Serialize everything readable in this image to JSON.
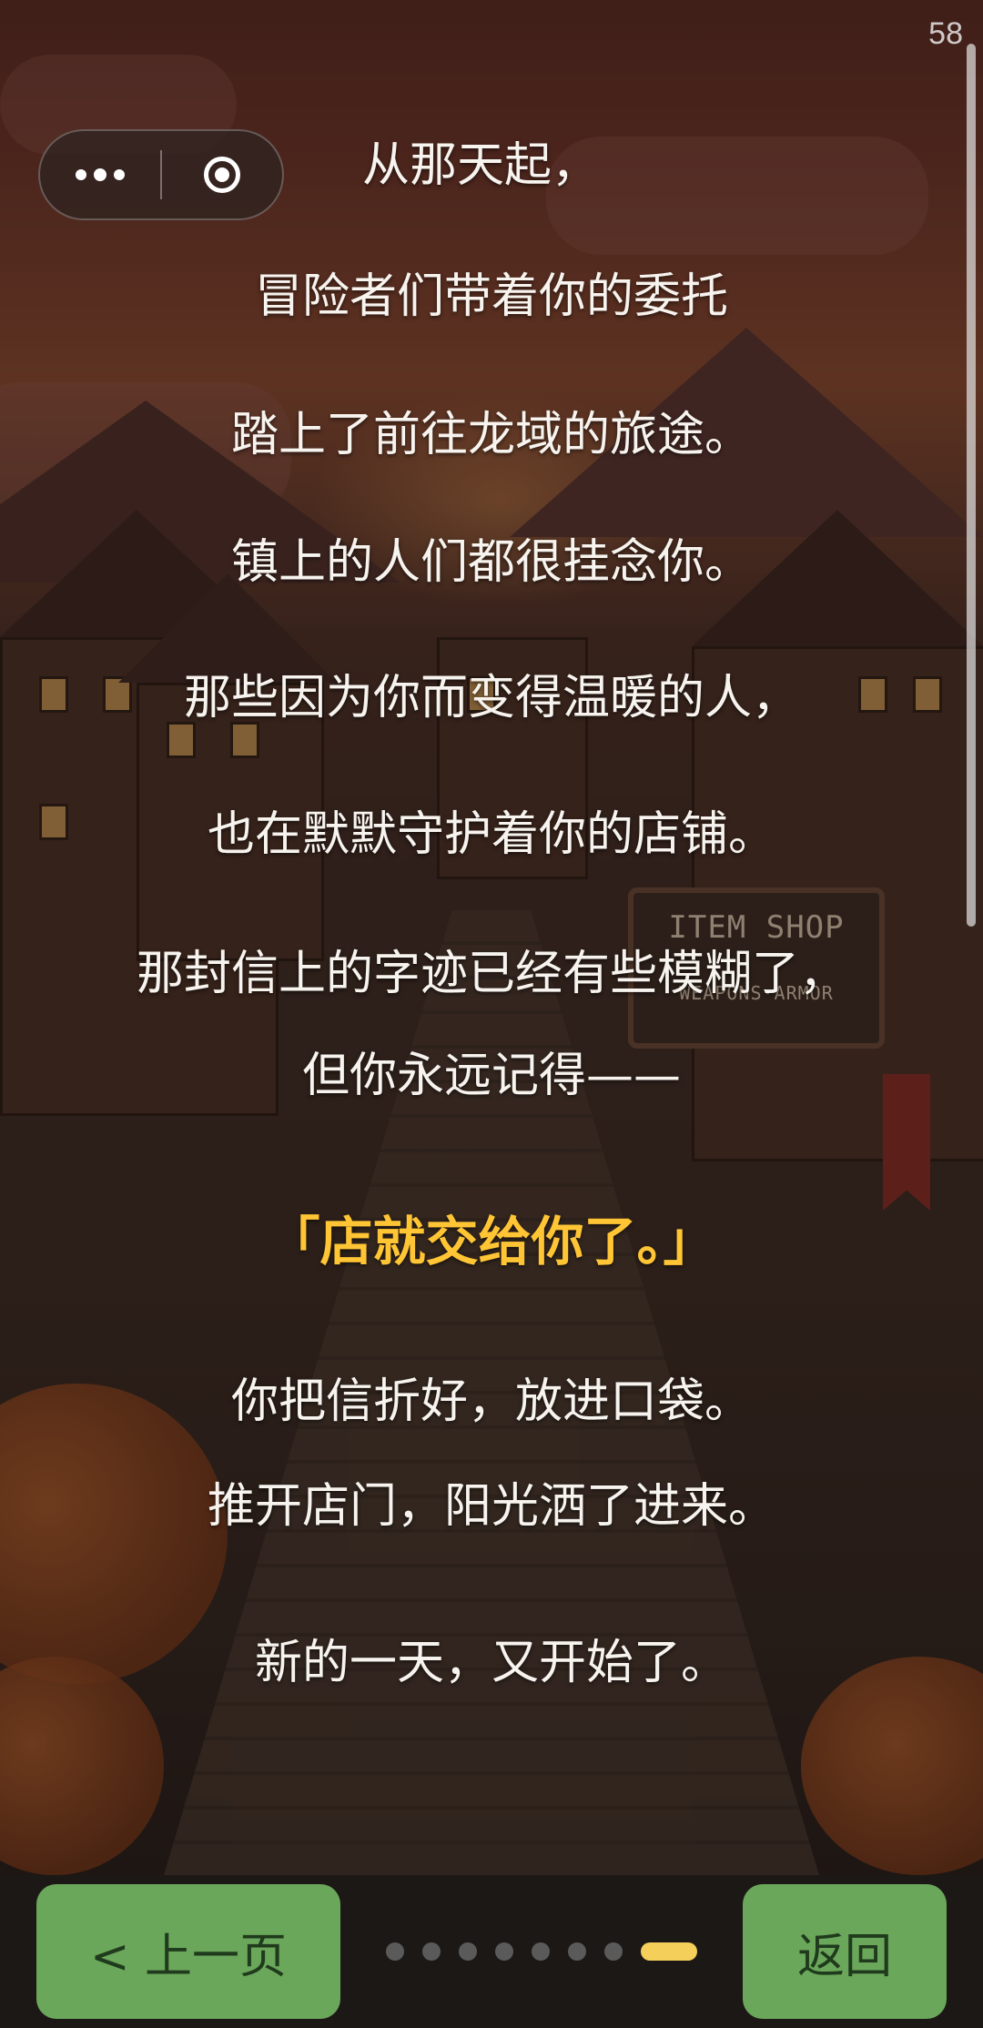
{
  "status": {
    "number": "58"
  },
  "capsule": {
    "more_icon": "more-dots-icon",
    "close_icon": "target-circle-icon"
  },
  "story": {
    "lines": [
      "从那天起，",
      "冒险者们带着你的委托",
      "踏上了前往龙域的旅途。",
      "镇上的人们都很挂念你。",
      "那些因为你而变得温暖的人，",
      "也在默默守护着你的店铺。",
      "那封信上的字迹已经有些模糊了，",
      "但你永远记得——",
      "「店就交给你了。」",
      "你把信折好，放进口袋。",
      "推开店门，阳光洒了进来。",
      "新的一天，又开始了。"
    ],
    "highlight_color": "#ffc534"
  },
  "scene": {
    "sign_line1": "ITEM SHOP",
    "sign_line2": "WEAPONS·ARMOR"
  },
  "nav": {
    "prev_label": "< 上一页",
    "back_label": "返回",
    "page_count": 8,
    "current_page": 8,
    "button_color": "#6aa75a",
    "active_dot_color": "#f4cf5a"
  }
}
